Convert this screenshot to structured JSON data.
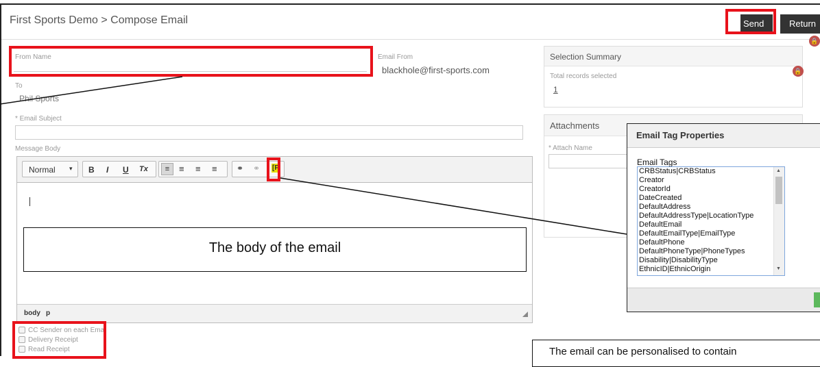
{
  "header": {
    "title": "First Sports Demo > Compose Email",
    "send_label": "Send",
    "return_label": "Return"
  },
  "form": {
    "from_name_label": "From Name",
    "from_name_value": "",
    "email_from_label": "Email From",
    "email_from_value": "blackhole@first-sports.com",
    "to_label": "To",
    "to_value": "Phil Sports",
    "subject_label": "* Email Subject",
    "subject_value": "",
    "message_body_label": "Message Body"
  },
  "editor": {
    "format_select": "Normal",
    "bold": "B",
    "italic": "I",
    "underline": "U",
    "clear_format": "Tx",
    "tag_button": "[F",
    "status_path_1": "body",
    "status_path_2": "p"
  },
  "options": {
    "cc_sender": "CC Sender on each Ema",
    "delivery_receipt": "Delivery Receipt",
    "read_receipt": "Read Receipt"
  },
  "summary": {
    "title": "Selection Summary",
    "total_label": "Total records selected",
    "total_value": "1"
  },
  "attachments": {
    "title": "Attachments",
    "attach_name_label": "* Attach Name"
  },
  "dialog": {
    "title": "Email Tag Properties",
    "tags_label": "Email Tags",
    "tags": [
      "CRBStatus|CRBStatus",
      "Creator",
      "CreatorId",
      "DateCreated",
      "DefaultAddress",
      "DefaultAddressType|LocationType",
      "DefaultEmail",
      "DefaultEmailType|EmailType",
      "DefaultPhone",
      "DefaultPhoneType|PhoneTypes",
      "Disability|DisabilityType",
      "EthnicID|EthnicOrigin"
    ]
  },
  "annotations": {
    "body_callout": "The body of the email",
    "personalise_callout": "The email can be personalised to contain"
  },
  "colors": {
    "highlight": "#e8121b",
    "button": "#333333",
    "lock": "#c0504d",
    "confirm": "#5cb85c"
  },
  "icons": {
    "lock": "lock-icon",
    "link": "link-icon",
    "unlink": "unlink-icon"
  }
}
